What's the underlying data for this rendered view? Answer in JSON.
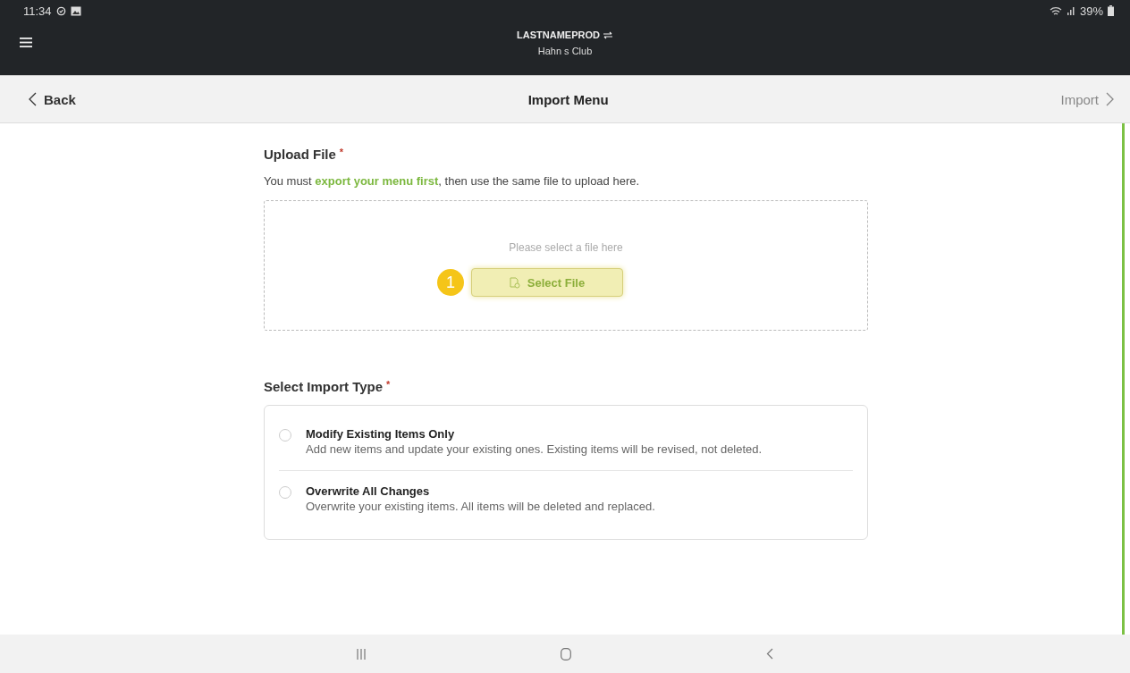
{
  "status_bar": {
    "time": "11:34",
    "battery": "39%"
  },
  "app_header": {
    "title": "LASTNAMEPROD",
    "subtitle": "Hahn s Club"
  },
  "nav_bar": {
    "back": "Back",
    "title": "Import Menu",
    "action": "Import",
    "action_disabled": true
  },
  "upload": {
    "heading": "Upload File",
    "required_mark": "*",
    "description": "You must **export your menu first**, then use the same file to upload here.",
    "hint": "Please select a file here",
    "step_badge": "1",
    "button": "Select File"
  },
  "import_type": {
    "heading": "Select Import Type",
    "required_mark": "*",
    "options": [
      {
        "title": "Modify Existing Items Only",
        "description": "Add new items and update your existing ones. Existing items will be revised, not deleted.",
        "selected": false
      },
      {
        "title": "Overwrite All Changes",
        "description": "Overwrite your existing items. All items will be deleted and replaced.",
        "selected": false
      }
    ]
  }
}
